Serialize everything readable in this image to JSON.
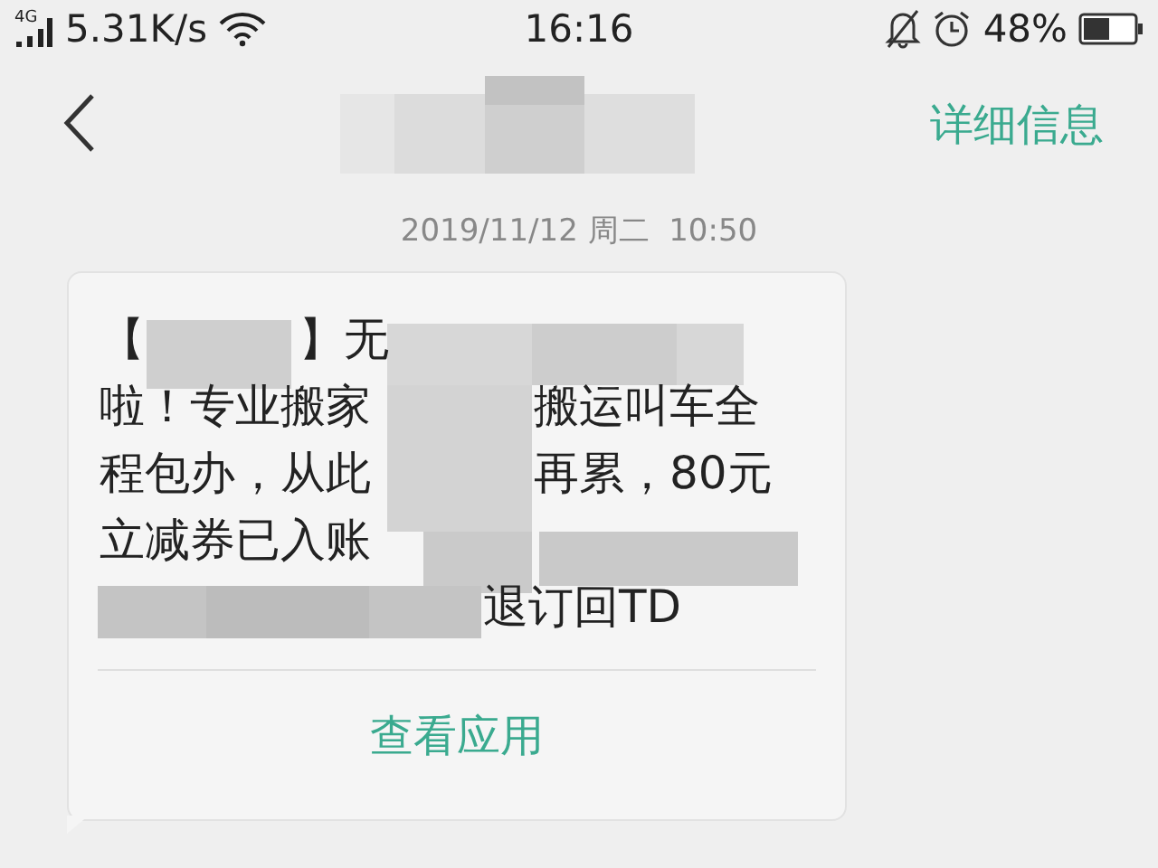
{
  "status_bar": {
    "network": "4G",
    "speed": "5.31K/s",
    "time": "16:16",
    "battery": "48%"
  },
  "header": {
    "action": "详细信息"
  },
  "date": "2019/11/12 周二  10:50",
  "message": {
    "lines": [
      [
        "【",
        "】无"
      ],
      [
        "啦！专业搬家",
        "搬运叫车全"
      ],
      [
        "程包办，从此",
        "再累，80元"
      ],
      [
        "立减券已入账"
      ],
      [
        "退订回TD"
      ]
    ],
    "action": "查看应用"
  }
}
